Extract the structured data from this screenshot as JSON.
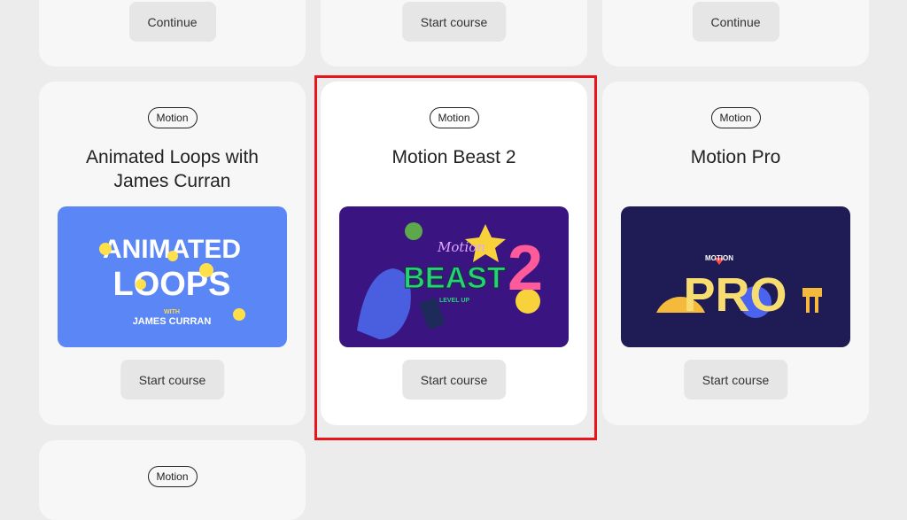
{
  "top_row": [
    {
      "button": "Continue"
    },
    {
      "button": "Start course"
    },
    {
      "button": "Continue"
    }
  ],
  "middle_row": [
    {
      "tag": "Motion",
      "title": "Animated Loops with James Curran",
      "button": "Start course",
      "thumb": {
        "line1": "ANIMATED",
        "line2": "LOOPS",
        "with": "WITH",
        "author": "JAMES CURRAN",
        "bg": "#5b86f5"
      }
    },
    {
      "tag": "Motion",
      "title": "Motion Beast 2",
      "button": "Start course",
      "thumb": {
        "script": "Motion",
        "word": "BEAST",
        "number": "2",
        "sub": "LEVEL UP",
        "bg": "#3a1480"
      }
    },
    {
      "tag": "Motion",
      "title": "Motion Pro",
      "button": "Start course",
      "thumb": {
        "small": "MOTION",
        "word": "PRO",
        "bg": "#1e1b55"
      }
    }
  ],
  "bottom_row": [
    {
      "tag": "Motion"
    }
  ]
}
